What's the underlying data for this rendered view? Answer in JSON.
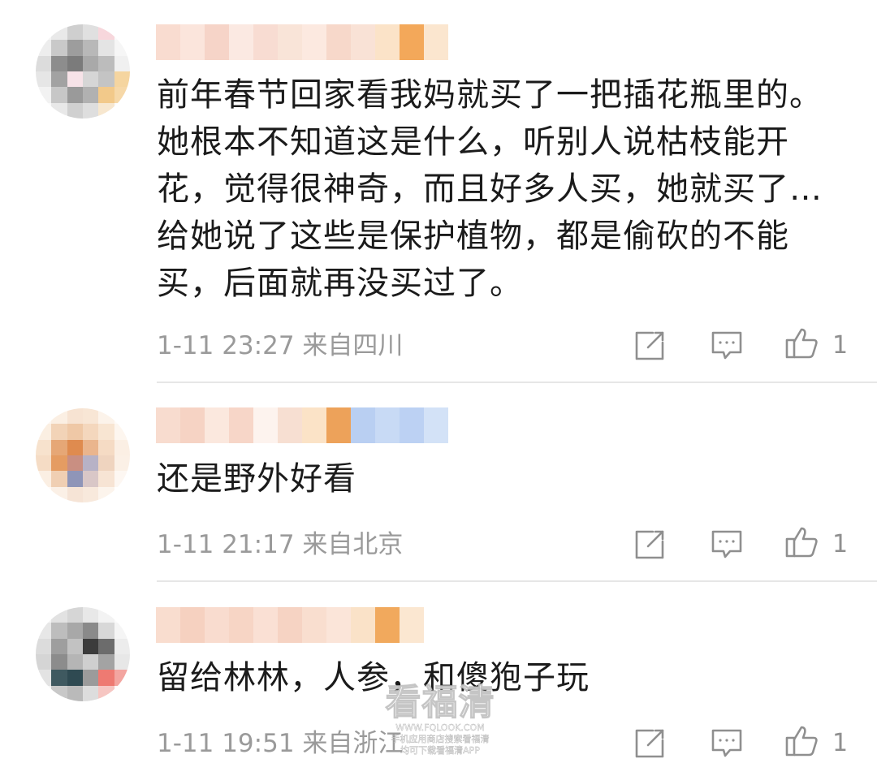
{
  "colors": {
    "text": "#1b1b1b",
    "meta": "#9a9a9a",
    "icon": "#8f8f8f",
    "divider": "#e6e6e6"
  },
  "comments": [
    {
      "text": "前年春节回家看我妈就买了一把插花瓶里的。\n她根本不知道这是什么，听别人说枯枝能开\n花，觉得很神奇，而且好多人买，她就买了…\n给她说了这些是保护植物，都是偷砍的不能\n买，后面就再没买过了。",
      "time": "1-11 23:27",
      "location": "来自四川",
      "likes": "1",
      "username_blurred": true
    },
    {
      "text": "还是野外好看",
      "time": "1-11 21:17",
      "location": "来自北京",
      "likes": "1",
      "username_blurred": true
    },
    {
      "text": "留给林林，人参，和傻狍子玩",
      "time": "1-11 19:51",
      "location": "来自浙江",
      "likes": "1",
      "username_blurred": true
    }
  ],
  "icons": {
    "share": "share-edit-icon",
    "comment": "comment-bubble-icon",
    "like": "thumbs-up-icon"
  },
  "watermark": {
    "title": "看福清",
    "url": "WWW.FQLOOK.COM",
    "line1": "手机应用商店搜索看福清",
    "line2": "均可下载看福清APP"
  }
}
